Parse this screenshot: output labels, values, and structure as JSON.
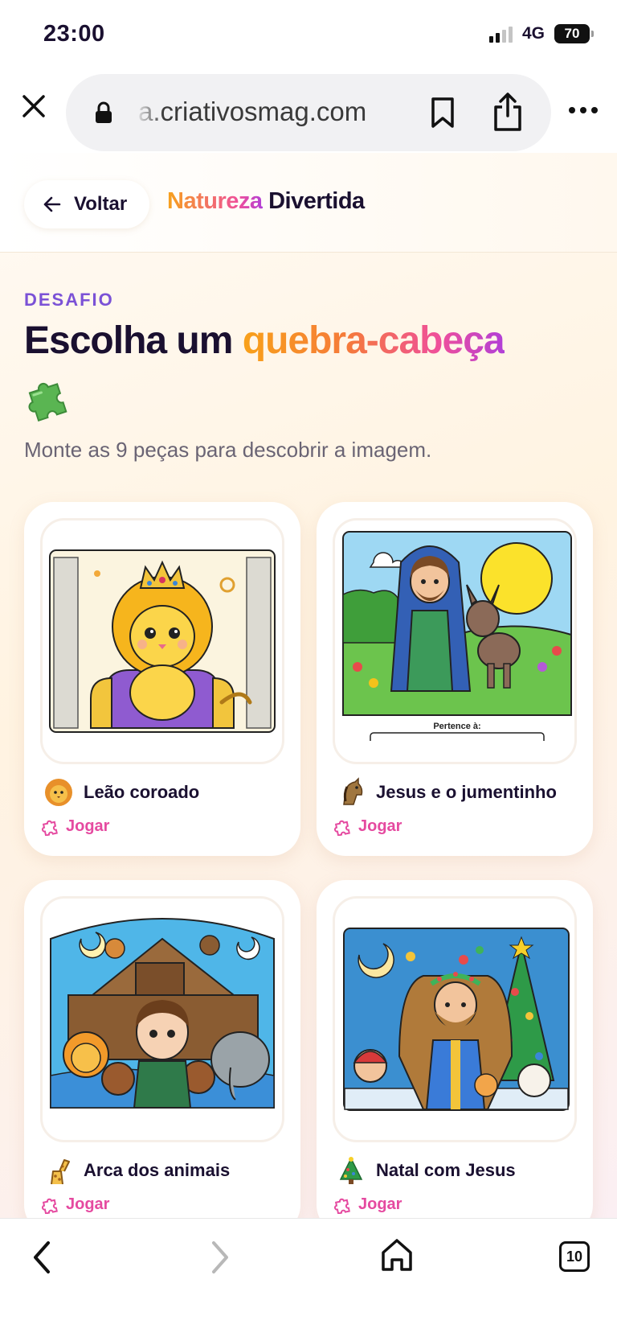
{
  "status": {
    "time": "23:00",
    "network": "4G",
    "battery": "70"
  },
  "browser": {
    "url": "a.criativosmag.com"
  },
  "header": {
    "back_label": "Voltar",
    "brand_part1": "Natureza",
    "brand_part2": "Divertida"
  },
  "intro": {
    "kicker": "DESAFIO",
    "title_plain": "Escolha um",
    "title_accent": "quebra-cabeça",
    "subtitle": "Monte as 9 peças para descobrir a imagem."
  },
  "cards": [
    {
      "emoji": "lion-emoji",
      "title": "Leão coroado",
      "play_label": "Jogar"
    },
    {
      "emoji": "horse-emoji",
      "title": "Jesus e o jumentinho",
      "play_label": "Jogar",
      "caption": "Pertence à:"
    },
    {
      "emoji": "giraffe-emoji",
      "title": "Arca dos animais",
      "play_label": "Jogar"
    },
    {
      "emoji": "christmas-tree-emoji",
      "title": "Natal com Jesus",
      "play_label": "Jogar"
    }
  ],
  "toolbar": {
    "tabs_count": "10"
  },
  "colors": {
    "brand_purple": "#7b52d6",
    "accent_pink": "#e54aa0",
    "accent_orange": "#f8a11a",
    "ink": "#1a1030"
  }
}
